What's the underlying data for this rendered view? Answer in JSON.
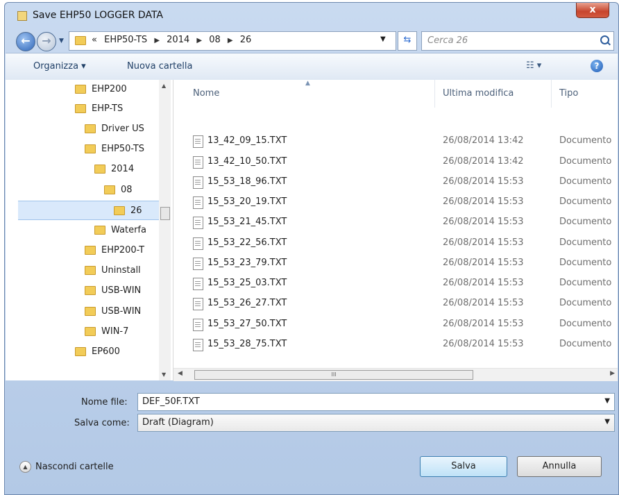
{
  "window": {
    "title": "Save EHP50 LOGGER DATA",
    "close_label": "x"
  },
  "address": {
    "breadcrumbs": [
      "«",
      "EHP50-TS",
      "2014",
      "08",
      "26"
    ],
    "search_placeholder": "Cerca 26"
  },
  "toolbar": {
    "organize_label": "Organizza ▾",
    "new_folder_label": "Nuova cartella",
    "view_label": "☷ ▾",
    "help_label": "?"
  },
  "nav_tree": [
    {
      "label": "EHP200",
      "selected": false
    },
    {
      "label": "EHP-TS",
      "selected": false
    },
    {
      "label": "Driver US",
      "selected": false
    },
    {
      "label": "EHP50-TS",
      "selected": false
    },
    {
      "label": "2014",
      "selected": false
    },
    {
      "label": "08",
      "selected": false
    },
    {
      "label": "26",
      "selected": true
    },
    {
      "label": "Waterfa",
      "selected": false
    },
    {
      "label": "EHP200-T",
      "selected": false
    },
    {
      "label": "Uninstall",
      "selected": false
    },
    {
      "label": "USB-WIN",
      "selected": false
    },
    {
      "label": "USB-WIN",
      "selected": false
    },
    {
      "label": "WIN-7",
      "selected": false
    },
    {
      "label": "EP600",
      "selected": false
    }
  ],
  "columns": {
    "name": "Nome",
    "modified": "Ultima modifica",
    "type": "Tipo"
  },
  "files": [
    {
      "name": "13_42_09_15.TXT",
      "modified": "26/08/2014 13:42",
      "type": "Documento"
    },
    {
      "name": "13_42_10_50.TXT",
      "modified": "26/08/2014 13:42",
      "type": "Documento"
    },
    {
      "name": "15_53_18_96.TXT",
      "modified": "26/08/2014 15:53",
      "type": "Documento"
    },
    {
      "name": "15_53_20_19.TXT",
      "modified": "26/08/2014 15:53",
      "type": "Documento"
    },
    {
      "name": "15_53_21_45.TXT",
      "modified": "26/08/2014 15:53",
      "type": "Documento"
    },
    {
      "name": "15_53_22_56.TXT",
      "modified": "26/08/2014 15:53",
      "type": "Documento"
    },
    {
      "name": "15_53_23_79.TXT",
      "modified": "26/08/2014 15:53",
      "type": "Documento"
    },
    {
      "name": "15_53_25_03.TXT",
      "modified": "26/08/2014 15:53",
      "type": "Documento"
    },
    {
      "name": "15_53_26_27.TXT",
      "modified": "26/08/2014 15:53",
      "type": "Documento"
    },
    {
      "name": "15_53_27_50.TXT",
      "modified": "26/08/2014 15:53",
      "type": "Documento"
    },
    {
      "name": "15_53_28_75.TXT",
      "modified": "26/08/2014 15:53",
      "type": "Documento"
    }
  ],
  "form": {
    "filename_label": "Nome file:",
    "filename_value": "DEF_50F.TXT",
    "savetype_label": "Salva come:",
    "savetype_value": "Draft (Diagram)"
  },
  "footer": {
    "hide_folders_label": "Nascondi cartelle",
    "save_label": "Salva",
    "cancel_label": "Annulla"
  },
  "colors": {
    "selection": "#d9e9fb",
    "accent": "#3c7fb1",
    "folder": "#f2cc58"
  }
}
